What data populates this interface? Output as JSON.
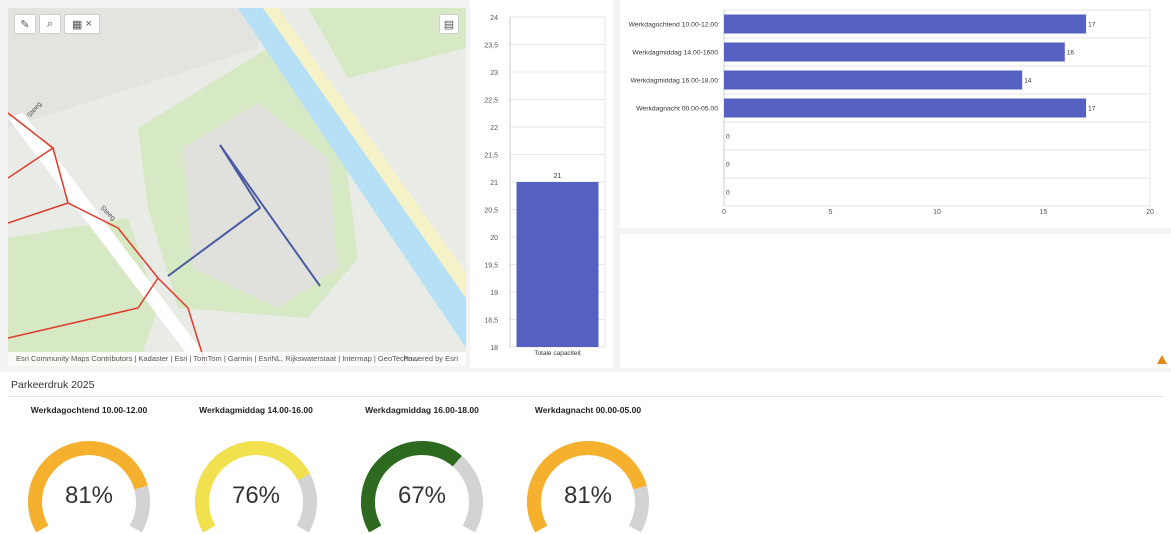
{
  "map": {
    "tools": [
      {
        "name": "edit-tool-button",
        "icon": "pencil-icon",
        "glyph": "✎"
      },
      {
        "name": "select-tool-button",
        "icon": "zoom-select-icon",
        "glyph": "⌕"
      },
      {
        "name": "table-tool-button",
        "icon": "table-icon",
        "glyph": "▦",
        "close": "×"
      }
    ],
    "layer_list_icon": "layer-list-icon",
    "streets": [
      "Steeg",
      "Steeg"
    ],
    "attribution": "Esri Community Maps Contributors | Kadaster | Esri | TomTom | Garmin | EsriNL, Rijkswaterstaat | Intermap | GeoTechn...",
    "powered_by": "Powered by Esri",
    "colors": {
      "land": "#e9ebe6",
      "green": "#d6e8c4",
      "water": "#b6e0f6",
      "building": "#dcdcdc",
      "road": "#ffffff",
      "redline": "#e03a2a",
      "blueline": "#4a5aa3"
    }
  },
  "capacity_chart": {
    "chart_data": {
      "type": "bar",
      "categories": [
        "Totale capaciteit"
      ],
      "values": [
        21
      ],
      "ylim": [
        18,
        24
      ],
      "yticks": [
        "18",
        "18,5",
        "19",
        "19,5",
        "20",
        "20,5",
        "21",
        "21,5",
        "22",
        "22,5",
        "23",
        "23,5",
        "24"
      ],
      "data_labels": [
        "21"
      ],
      "bar_color": "#5560c0"
    }
  },
  "time_chart": {
    "chart_data": {
      "type": "bar",
      "orientation": "horizontal",
      "categories": [
        "Werkdagochtend 10.00-12.00",
        "Werkdagmiddag 14.00-1600",
        "Werkdagmiddag 16.00-18.00",
        "Werkdagnacht 00.00-05.00",
        "",
        "",
        ""
      ],
      "values": [
        17,
        16,
        14,
        17,
        0,
        0,
        0
      ],
      "data_labels": [
        "17",
        "16",
        "14",
        "17",
        "0",
        "0",
        "0"
      ],
      "xlim": [
        0,
        20
      ],
      "xticks": [
        "0",
        "5",
        "10",
        "15",
        "20"
      ],
      "bar_color": "#5560c0"
    }
  },
  "parking": {
    "title": "Parkeerdruk 2025",
    "gauges": [
      {
        "label": "Werkdagochtend 10.00-12.00",
        "value": "81%",
        "fraction": 0.81,
        "color": "#f5b12e"
      },
      {
        "label": "Werkdagmiddag 14.00-16.00",
        "value": "76%",
        "fraction": 0.76,
        "color": "#f2e14e"
      },
      {
        "label": "Werkdagmiddag 16.00-18.00",
        "value": "67%",
        "fraction": 0.67,
        "color": "#2d6a1f"
      },
      {
        "label": "Werkdagnacht 00.00-05.00",
        "value": "81%",
        "fraction": 0.81,
        "color": "#f5b12e"
      }
    ],
    "track_color": "#d3d3d3"
  }
}
